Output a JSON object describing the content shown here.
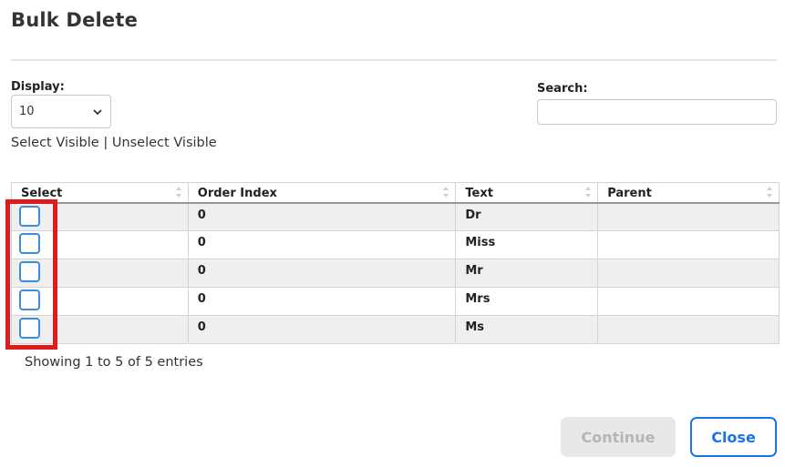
{
  "dialog": {
    "title": "Bulk Delete"
  },
  "display": {
    "label": "Display:",
    "value": "10"
  },
  "search": {
    "label": "Search:",
    "value": ""
  },
  "selection": {
    "select_visible": "Select Visible",
    "separator": " | ",
    "unselect_visible": "Unselect Visible"
  },
  "table": {
    "columns": [
      "Select",
      "Order Index",
      "Text",
      "Parent"
    ],
    "rows": [
      {
        "checked": false,
        "order_index": "0",
        "text": "Dr",
        "parent": ""
      },
      {
        "checked": false,
        "order_index": "0",
        "text": "Miss",
        "parent": ""
      },
      {
        "checked": false,
        "order_index": "0",
        "text": "Mr",
        "parent": ""
      },
      {
        "checked": false,
        "order_index": "0",
        "text": "Mrs",
        "parent": ""
      },
      {
        "checked": false,
        "order_index": "0",
        "text": "Ms",
        "parent": ""
      }
    ]
  },
  "info": {
    "entries": "Showing 1 to 5 of 5 entries"
  },
  "buttons": {
    "continue": "Continue",
    "close": "Close"
  },
  "colors": {
    "accent": "#1a73e8",
    "checkbox_border": "#3a8de0",
    "highlight": "#e01b1b",
    "disabled_bg": "#e8e8e8",
    "disabled_text": "#b5b5b5"
  },
  "icons": {
    "select_arrow": "chevron-down-icon",
    "sort": "sort-icon"
  }
}
